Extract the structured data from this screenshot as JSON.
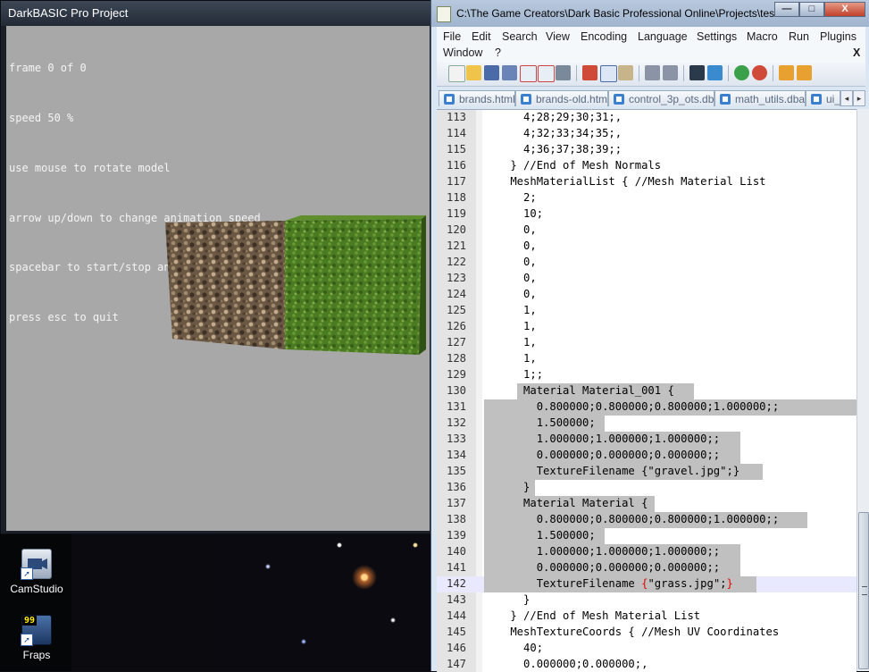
{
  "darkbasic": {
    "title": "DarkBASIC Pro Project",
    "lines": [
      "frame 0 of 0",
      "speed 50 %",
      "use mouse to rotate model",
      "arrow up/down to change animation speed",
      "spacebar to start/stop animation",
      "press esc to quit"
    ]
  },
  "desktop": {
    "icons": [
      {
        "label": "CamStudio"
      },
      {
        "label": "Fraps",
        "badge": "99"
      }
    ]
  },
  "npp": {
    "title": "C:\\The Game Creators\\Dark Basic Professional Online\\Projects\\tes...",
    "caption_buttons": {
      "minimize": "—",
      "maximize": "□",
      "close": "X"
    },
    "menu": [
      "File",
      "Edit",
      "Search",
      "View",
      "Encoding",
      "Language",
      "Settings",
      "Macro",
      "Run",
      "Plugins",
      "Window",
      "?"
    ],
    "menu_close": "X",
    "tabs": [
      "brands.html",
      "brands-old.html",
      "control_3p_ots.dba",
      "math_utils.dba",
      "ui_c"
    ],
    "tab_arrows": {
      "left": "◂",
      "right": "▸"
    },
    "lines": [
      {
        "n": "113",
        "text": "      4;28;29;30;31;,"
      },
      {
        "n": "114",
        "text": "      4;32;33;34;35;,"
      },
      {
        "n": "115",
        "text": "      4;36;37;38;39;;"
      },
      {
        "n": "116",
        "text": "    } //End of Mesh Normals"
      },
      {
        "n": "117",
        "text": "    MeshMaterialList { //Mesh Material List"
      },
      {
        "n": "118",
        "text": "      2;"
      },
      {
        "n": "119",
        "text": "      10;"
      },
      {
        "n": "120",
        "text": "      0,"
      },
      {
        "n": "121",
        "text": "      0,"
      },
      {
        "n": "122",
        "text": "      0,"
      },
      {
        "n": "123",
        "text": "      0,"
      },
      {
        "n": "124",
        "text": "      0,"
      },
      {
        "n": "125",
        "text": "      1,"
      },
      {
        "n": "126",
        "text": "      1,"
      },
      {
        "n": "127",
        "text": "      1,"
      },
      {
        "n": "128",
        "text": "      1,"
      },
      {
        "n": "129",
        "text": "      1;;"
      },
      {
        "n": "130",
        "text": "      Material Material_001 {"
      },
      {
        "n": "131",
        "text": "        0.800000;0.800000;0.800000;1.000000;;"
      },
      {
        "n": "132",
        "text": "        1.500000;"
      },
      {
        "n": "133",
        "text": "        1.000000;1.000000;1.000000;;"
      },
      {
        "n": "134",
        "text": "        0.000000;0.000000;0.000000;;"
      },
      {
        "n": "135",
        "text": "        TextureFilename {\"gravel.jpg\";}"
      },
      {
        "n": "136",
        "text": "      }"
      },
      {
        "n": "137",
        "text": "      Material Material {"
      },
      {
        "n": "138",
        "text": "        0.800000;0.800000;0.800000;1.000000;;"
      },
      {
        "n": "139",
        "text": "        1.500000;"
      },
      {
        "n": "140",
        "text": "        1.000000;1.000000;1.000000;;"
      },
      {
        "n": "141",
        "text": "        0.000000;0.000000;0.000000;;"
      },
      {
        "n": "142",
        "text": "        TextureFilename {\"grass.jpg\";}"
      },
      {
        "n": "143",
        "text": "      }"
      },
      {
        "n": "144",
        "text": "    } //End of Mesh Material List"
      },
      {
        "n": "145",
        "text": "    MeshTextureCoords { //Mesh UV Coordinates"
      },
      {
        "n": "146",
        "text": "      40;"
      },
      {
        "n": "147",
        "text": "      0.000000;0.000000;,"
      }
    ]
  }
}
